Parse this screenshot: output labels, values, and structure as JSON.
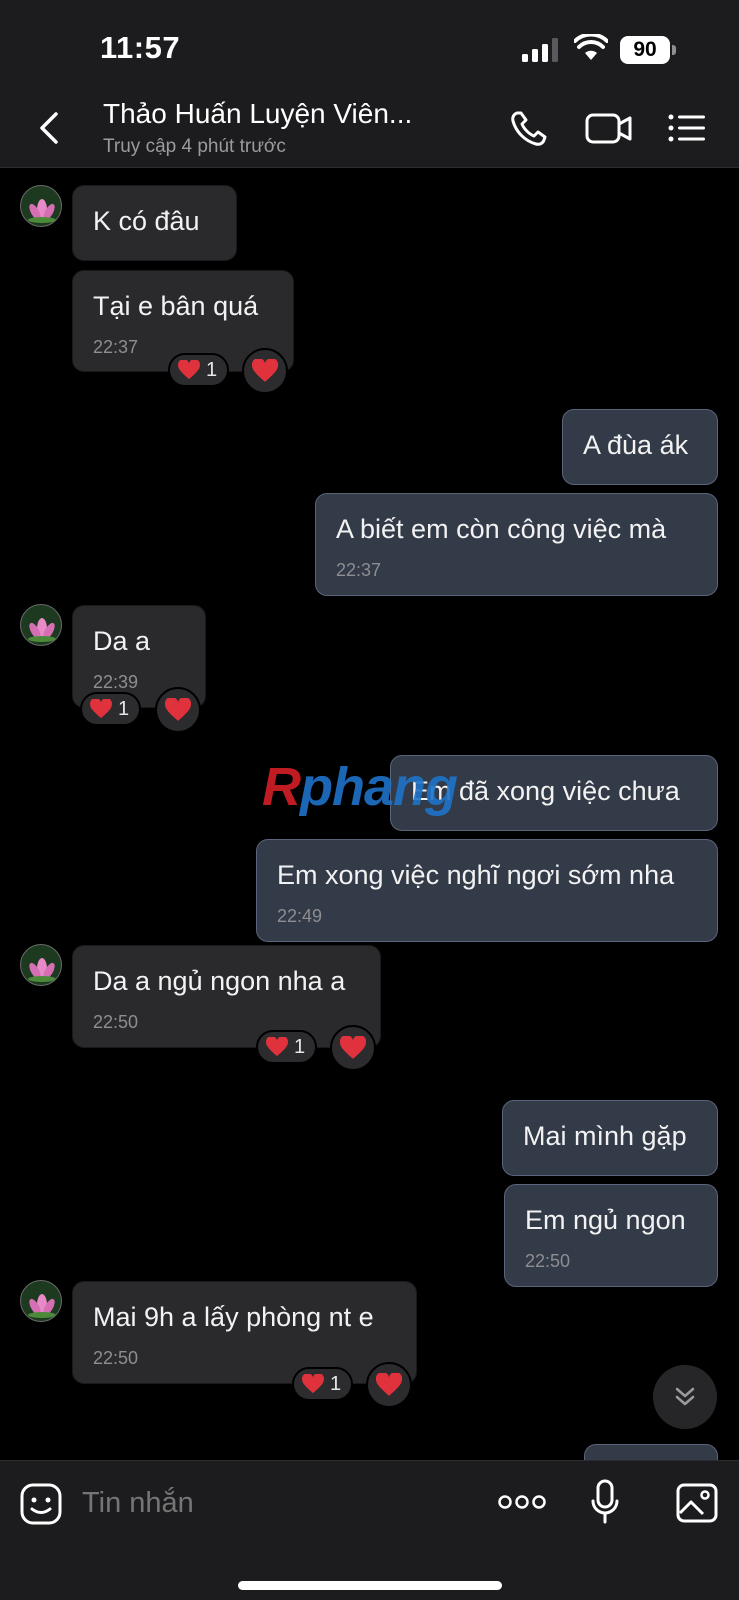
{
  "status_bar": {
    "time": "11:57",
    "battery": "90"
  },
  "header": {
    "title": "Thảo Huấn Luyện Viên...",
    "subtitle": "Truy cập 4 phút trước"
  },
  "messages": [
    {
      "side": "received",
      "text": "K có đâu"
    },
    {
      "side": "received",
      "text": "Tại e bân quá",
      "time": "22:37",
      "reaction_count": "1"
    },
    {
      "side": "sent",
      "text": "A đùa ák"
    },
    {
      "side": "sent",
      "text": "A biết em còn công việc mà",
      "time": "22:37"
    },
    {
      "side": "received",
      "text": "Da a",
      "time": "22:39",
      "reaction_count": "1"
    },
    {
      "side": "sent",
      "text": "Em đã xong việc chưa"
    },
    {
      "side": "sent",
      "text": "Em xong việc nghĩ ngơi sớm nha",
      "time": "22:49"
    },
    {
      "side": "received",
      "text": "Da a ngủ ngon nha a",
      "time": "22:50",
      "reaction_count": "1"
    },
    {
      "side": "sent",
      "text": "Mai mình gặp"
    },
    {
      "side": "sent",
      "text": "Em ngủ ngon",
      "time": "22:50"
    },
    {
      "side": "received",
      "text": "Mai 9h a lấy phòng nt e",
      "time": "22:50",
      "reaction_count": "1"
    }
  ],
  "watermark": {
    "r": "R",
    "rest": "phang"
  },
  "composer": {
    "placeholder": "Tin nhắn"
  },
  "colors": {
    "received_bubble": "#2a2a2d",
    "sent_bubble": "#333a48",
    "sent_border": "#59657a",
    "heart": "#e0323c",
    "background": "#000000"
  },
  "icons": [
    "back-chevron-icon",
    "phone-icon",
    "video-camera-icon",
    "list-menu-icon",
    "heart-icon",
    "chevron-double-down-icon",
    "sticker-face-icon",
    "more-dots-icon",
    "microphone-icon",
    "image-gallery-icon"
  ]
}
